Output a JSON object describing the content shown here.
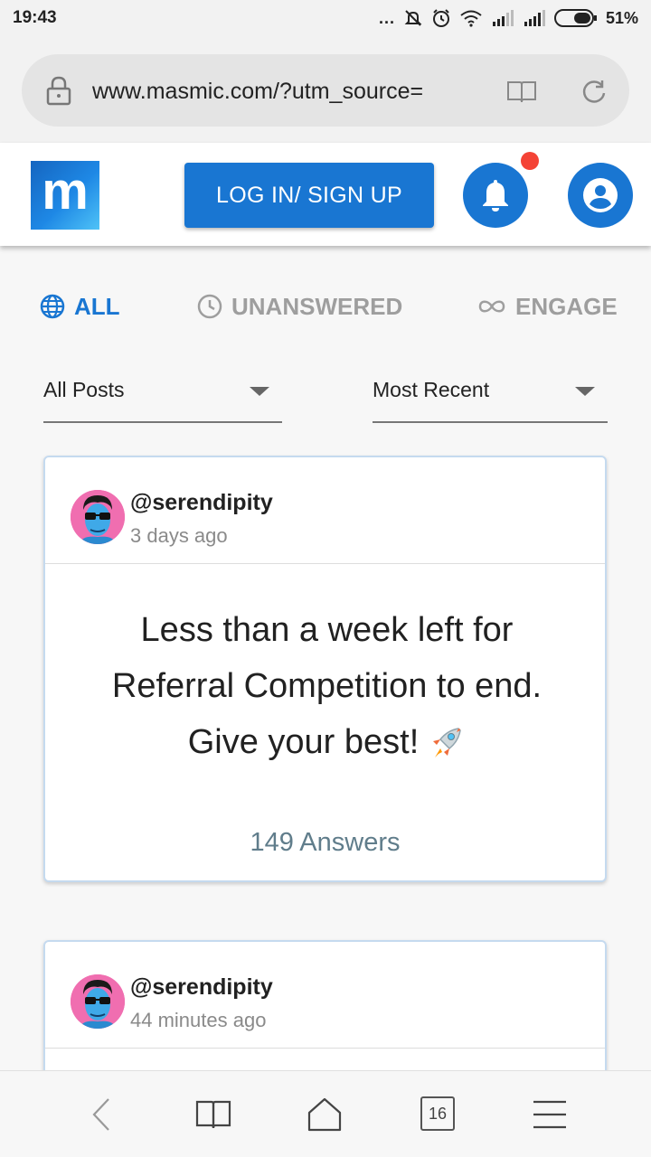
{
  "status_bar": {
    "time": "19:43",
    "dots": "...",
    "battery_percent": "51%"
  },
  "browser": {
    "url": "www.masmic.com/?utm_source="
  },
  "header": {
    "logo_letter": "m",
    "login_label": "LOG IN/ SIGN UP",
    "notification_dot_color": "#f44336"
  },
  "tabs": [
    {
      "label": "ALL",
      "icon": "globe-icon",
      "active": true
    },
    {
      "label": "UNANSWERED",
      "icon": "clock-icon",
      "active": false
    },
    {
      "label": "ENGAGE",
      "icon": "infinity-icon",
      "active": false
    }
  ],
  "filters": {
    "posts": "All Posts",
    "sort": "Most Recent"
  },
  "posts": [
    {
      "author": "@serendipity",
      "time": "3 days ago",
      "lines": [
        "Less than a week left for",
        "Referral Competition to end.",
        "Give your best!"
      ],
      "answers": "149 Answers"
    },
    {
      "author": "@serendipity",
      "time": "44 minutes ago"
    }
  ],
  "bottom_nav": {
    "tab_count": "16"
  },
  "colors": {
    "accent": "#1976d2",
    "muted_tab": "#9e9e9e",
    "answers": "#607d8b"
  }
}
